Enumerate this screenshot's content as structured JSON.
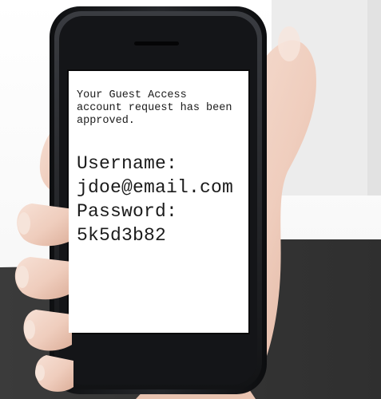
{
  "sms": {
    "message": "Your Guest Access account request has been approved.",
    "username_label": "Username:",
    "username_value": "jdoe@email.com",
    "password_label": "Password:",
    "password_value": "5k5d3b82"
  },
  "colors": {
    "background_top": "#ffffff",
    "background_bottom": "#3a3a3a",
    "phone_body": "#1c1d20",
    "screen": "#ffffff",
    "text": "#1b1b1b",
    "skin": "#f1d3c3"
  }
}
